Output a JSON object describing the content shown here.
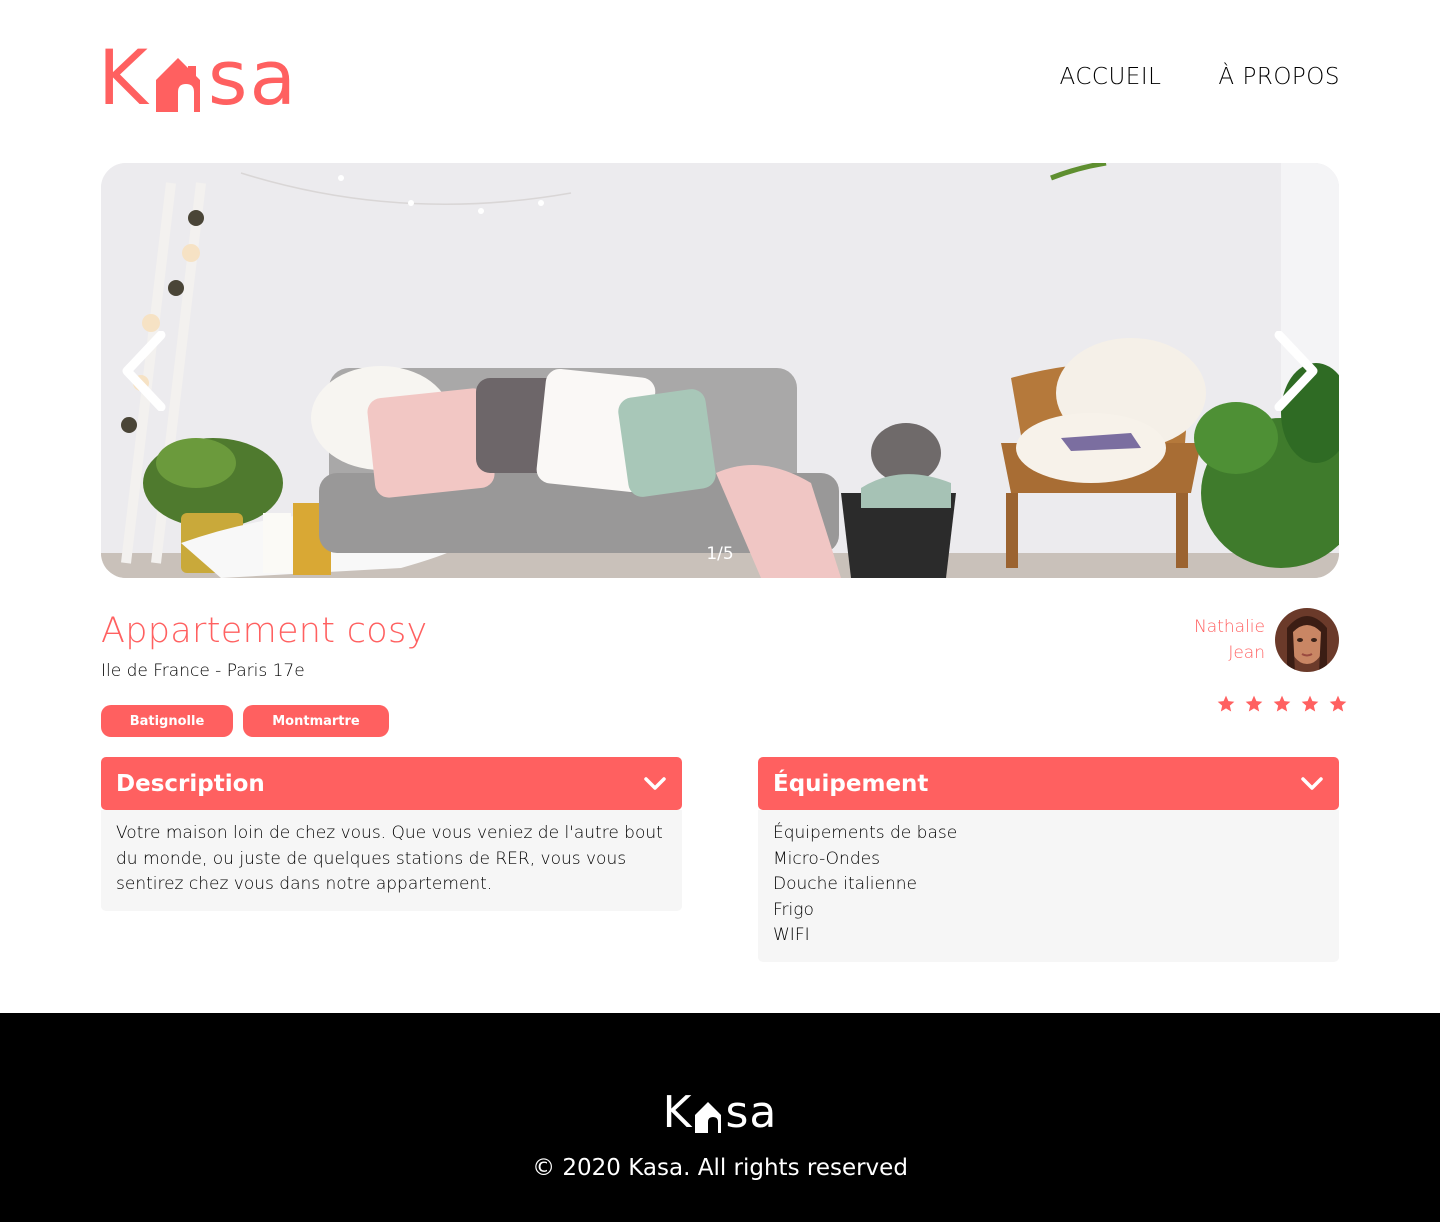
{
  "brand": {
    "name_parts": [
      "K",
      "sa"
    ],
    "accent": "#FF6060"
  },
  "nav": {
    "items": [
      "ACCUEIL",
      "À PROPOS"
    ]
  },
  "gallery": {
    "counter": "1/5",
    "prev_icon": "chevron-left-icon",
    "next_icon": "chevron-right-icon"
  },
  "listing": {
    "title": "Appartement cosy",
    "location": "Ile de France - Paris 17e",
    "tags": [
      "Batignolle",
      "Montmartre"
    ],
    "rating": 5,
    "rating_max": 5
  },
  "host": {
    "first_name": "Nathalie",
    "last_name": "Jean"
  },
  "description": {
    "title": "Description",
    "text": "Votre maison loin de chez vous. Que vous veniez de l'autre bout du monde, ou juste de quelques stations de RER, vous vous sentirez chez vous dans notre appartement."
  },
  "equipment": {
    "title": "Équipement",
    "items": [
      "Équipements de base",
      "Micro-Ondes",
      "Douche italienne",
      "Frigo",
      "WIFI"
    ]
  },
  "footer": {
    "brand_parts": [
      "K",
      "sa"
    ],
    "copyright": "© 2020 Kasa. All rights reserved"
  }
}
